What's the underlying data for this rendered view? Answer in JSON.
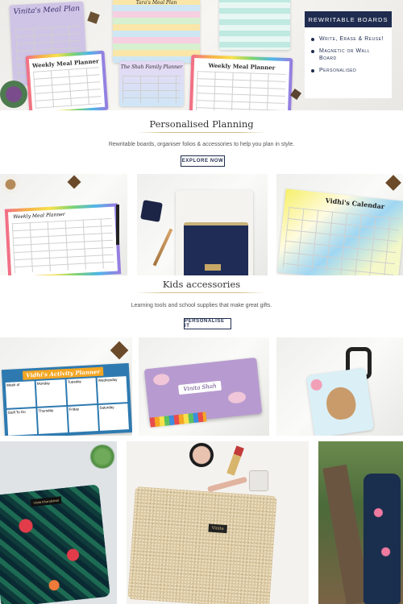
{
  "hero": {
    "boards": {
      "meal_plan_title": "Vinita's Meal Plan",
      "weekly_meal_planner_1": "Weekly Meal Planner",
      "meal_planner_top": "Tara's Meal Plan",
      "weekly_meal_planner_2": "Weekly Meal Planner",
      "family_planner": "The Shah Family Planner"
    },
    "promo": {
      "heading": "Rewritable Boards",
      "items": [
        "Write, Erase & Reuse!",
        "Magnetic or Wall Board",
        "Personalised"
      ]
    }
  },
  "planning": {
    "title": "Personalised Planning",
    "subtitle": "Rewritable boards, organiser folios & accessories to help you plan in style.",
    "button": "Explore Now",
    "tiles": {
      "board_title": "Weekly Meal Planner",
      "calendar_title": "Vidhi's Calendar"
    }
  },
  "kids": {
    "title": "Kids accessories",
    "subtitle": "Learning tools and school supplies that make great gifts.",
    "button": "Personalise It",
    "tiles": {
      "activity_title": "Vidhi's Activity Planner",
      "days": [
        "Week of",
        "Monday",
        "Tuesday",
        "Wednesday",
        "Stuff To Do",
        "Thursday",
        "Friday",
        "Saturday"
      ],
      "pencil_box_name": "Vinita Shah"
    }
  },
  "bottom": {
    "pouch_label": "Vinita Khandelwal",
    "clutch_label": "Vinita"
  }
}
